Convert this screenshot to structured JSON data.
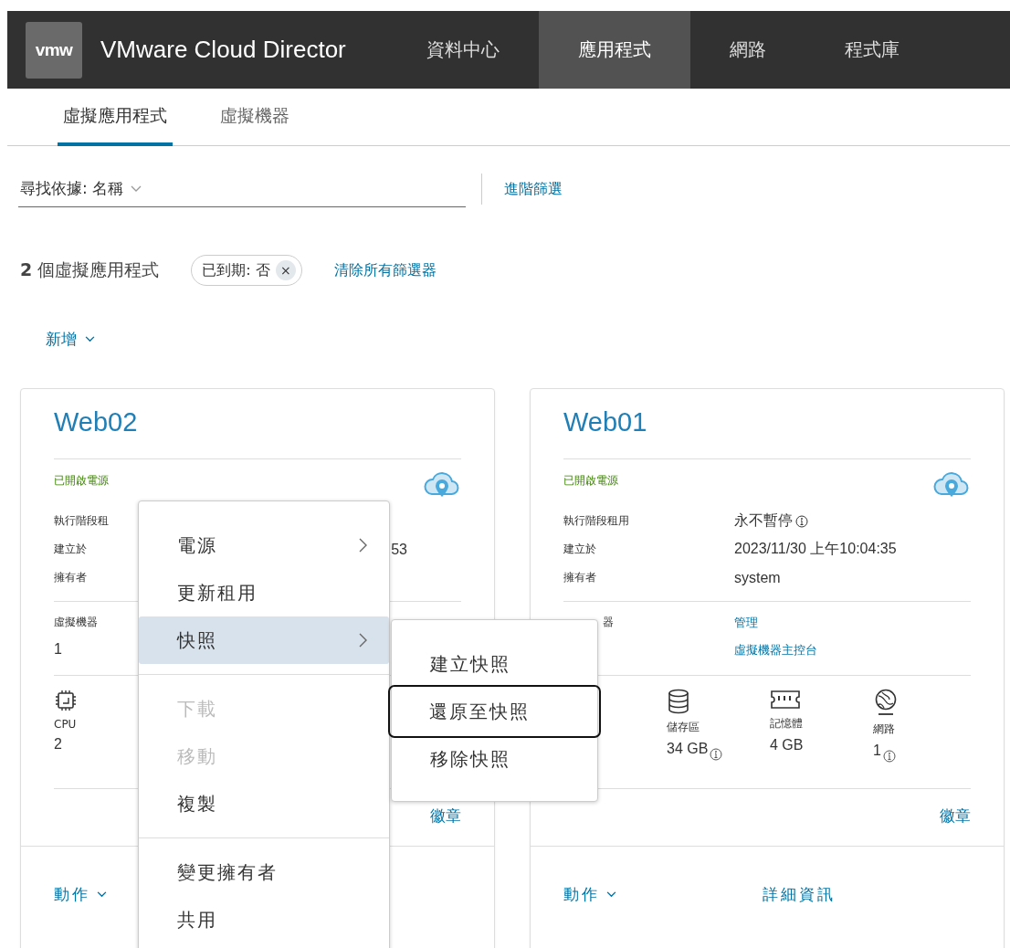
{
  "header": {
    "logo": "vmw",
    "title": "VMware Cloud Director",
    "nav": [
      {
        "label": "資料中心",
        "selected": false
      },
      {
        "label": "應用程式",
        "selected": true
      },
      {
        "label": "網路",
        "selected": false
      },
      {
        "label": "程式庫",
        "selected": false
      }
    ]
  },
  "sub_tabs": [
    {
      "label": "虛擬應用程式",
      "selected": true
    },
    {
      "label": "虛擬機器",
      "selected": false
    }
  ],
  "search": {
    "value": "尋找依據: 名稱"
  },
  "advanced_filter": "進階篩選",
  "count": "**2** 個虛擬應用程式",
  "filter_chip": {
    "label": "已到期: 否",
    "remove": "×"
  },
  "clear_filters": "清除所有篩選器",
  "add_button": "新增",
  "cards": [
    {
      "title": "Web02",
      "status": "已開啟電源",
      "fields": [
        {
          "label": "執行階段租",
          "info": false
        },
        {
          "label": "建立於",
          "value": "53",
          "info": false
        },
        {
          "label": "擁有者",
          "info": false
        }
      ],
      "vm": {
        "label": "虛擬機器",
        "value": "1"
      },
      "metrics": [
        {
          "kind": "cpu",
          "label": "CPU",
          "value": "2",
          "info": false
        }
      ],
      "badge_link": "徽章",
      "actions": "動作"
    },
    {
      "title": "Web01",
      "status": "已開啟電源",
      "fields": [
        {
          "label": "執行階段租用",
          "value": "永不暫停",
          "info": true
        },
        {
          "label": "建立於",
          "value": "2023/11/30 上午10:04:35",
          "info": false
        },
        {
          "label": "擁有者",
          "value": "system",
          "info": false
        }
      ],
      "vm": {
        "label": "器",
        "links": [
          "管理",
          "虛擬機器主控台"
        ]
      },
      "metrics": [
        {
          "kind": "storage",
          "label": "儲存區",
          "value": "34 GB",
          "info": true
        },
        {
          "kind": "memory",
          "label": "記憶體",
          "value": "4 GB",
          "info": false
        },
        {
          "kind": "network",
          "label": "網路",
          "value": "1",
          "info": true
        }
      ],
      "badge_link": "徽章",
      "actions": "動作",
      "details": "詳細資訊"
    }
  ],
  "context_menu": {
    "groups": [
      [
        {
          "label": "電源",
          "submenu": true,
          "selected": false,
          "disabled": false
        },
        {
          "label": "更新租用",
          "submenu": false,
          "selected": false,
          "disabled": false
        },
        {
          "label": "快照",
          "submenu": true,
          "selected": true,
          "disabled": false
        }
      ],
      [
        {
          "label": "下載",
          "submenu": false,
          "selected": false,
          "disabled": true
        },
        {
          "label": "移動",
          "submenu": false,
          "selected": false,
          "disabled": true
        },
        {
          "label": "複製",
          "submenu": false,
          "selected": false,
          "disabled": false
        }
      ],
      [
        {
          "label": "變更擁有者",
          "submenu": false,
          "selected": false,
          "disabled": false
        },
        {
          "label": "共用",
          "submenu": false,
          "selected": false,
          "disabled": false
        }
      ]
    ]
  },
  "submenu": {
    "items": [
      {
        "label": "建立快照",
        "focused": false
      },
      {
        "label": "還原至快照",
        "focused": true
      },
      {
        "label": "移除快照",
        "focused": false
      }
    ]
  }
}
